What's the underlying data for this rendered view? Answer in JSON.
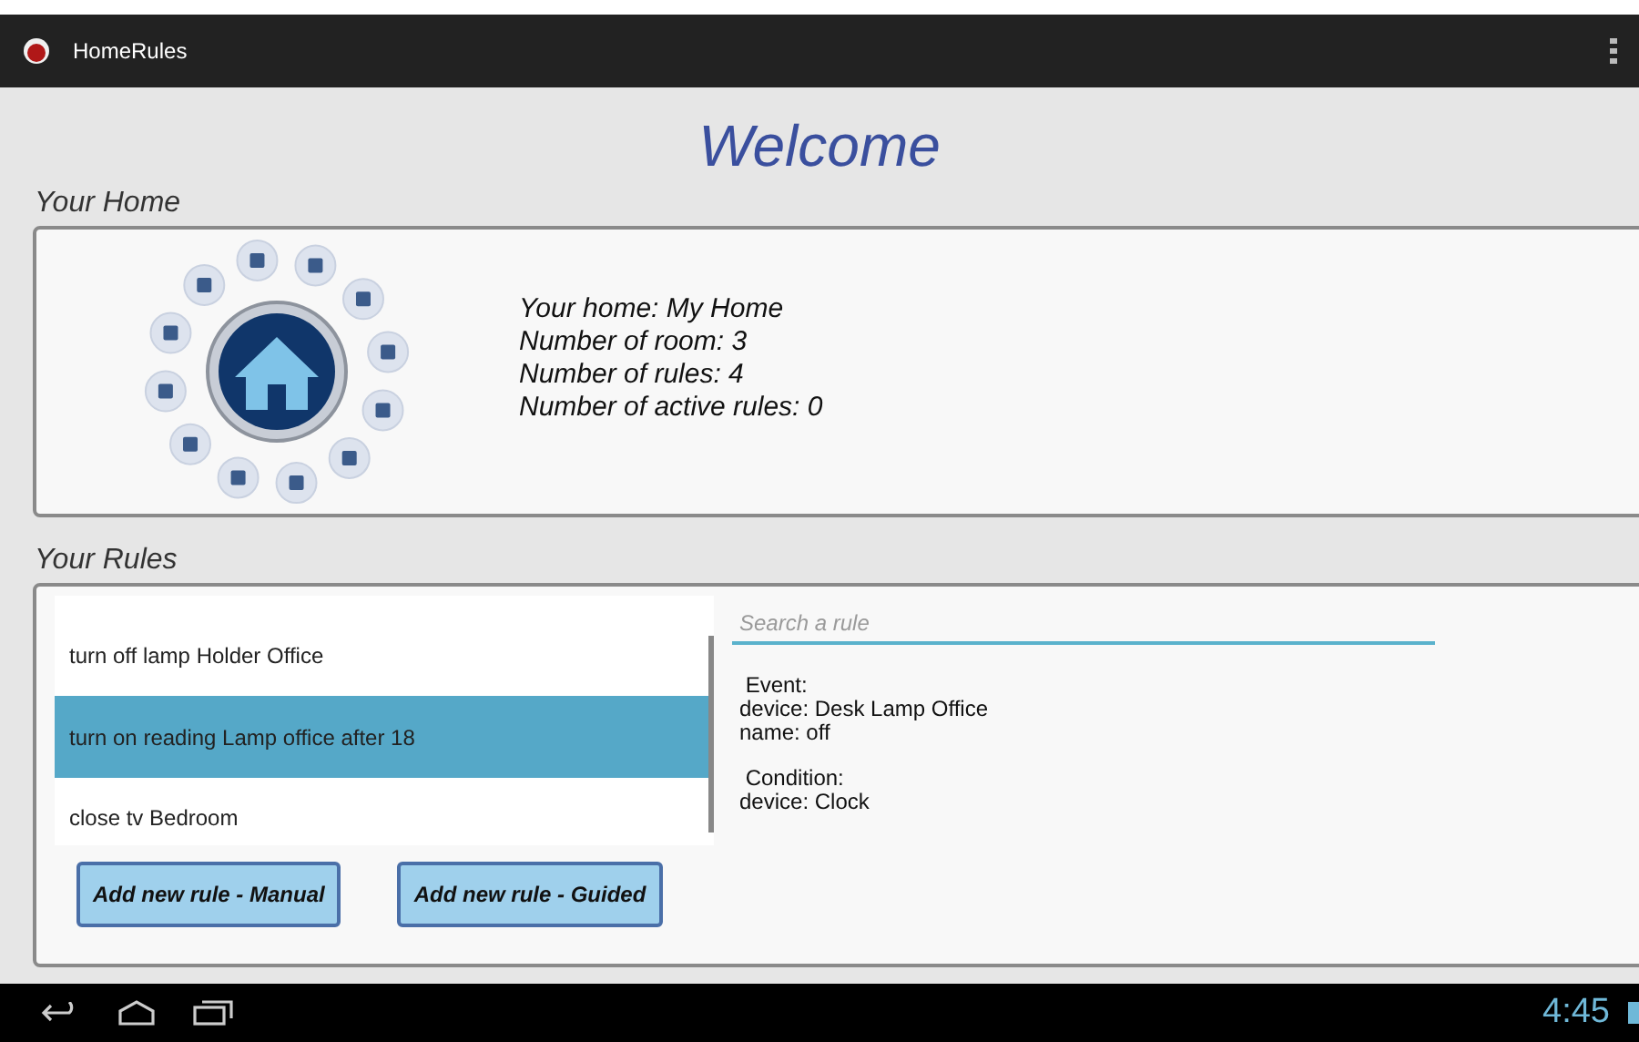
{
  "app_bar": {
    "title": "HomeRules"
  },
  "welcome": "Welcome",
  "home_section": {
    "heading": "Your Home",
    "info": [
      "Your home: My Home",
      "Number of room: 3",
      "Number of rules: 4",
      "Number of active rules: 0"
    ]
  },
  "rules_section": {
    "heading": "Your Rules",
    "rules": [
      {
        "label": "turn off lamp Holder Office",
        "selected": false
      },
      {
        "label": "turn on reading Lamp office after 18",
        "selected": true
      },
      {
        "label": "close tv Bedroom",
        "selected": false
      }
    ],
    "buttons": [
      "Add new rule - Manual",
      "Add new rule - Guided"
    ],
    "search": {
      "placeholder": "Search a rule"
    },
    "details": [
      [
        " Event:",
        "device: Desk Lamp Office",
        "name: off"
      ],
      [
        " Condition:",
        "device: Clock"
      ]
    ]
  },
  "nav_bar": {
    "time": "4:45"
  }
}
